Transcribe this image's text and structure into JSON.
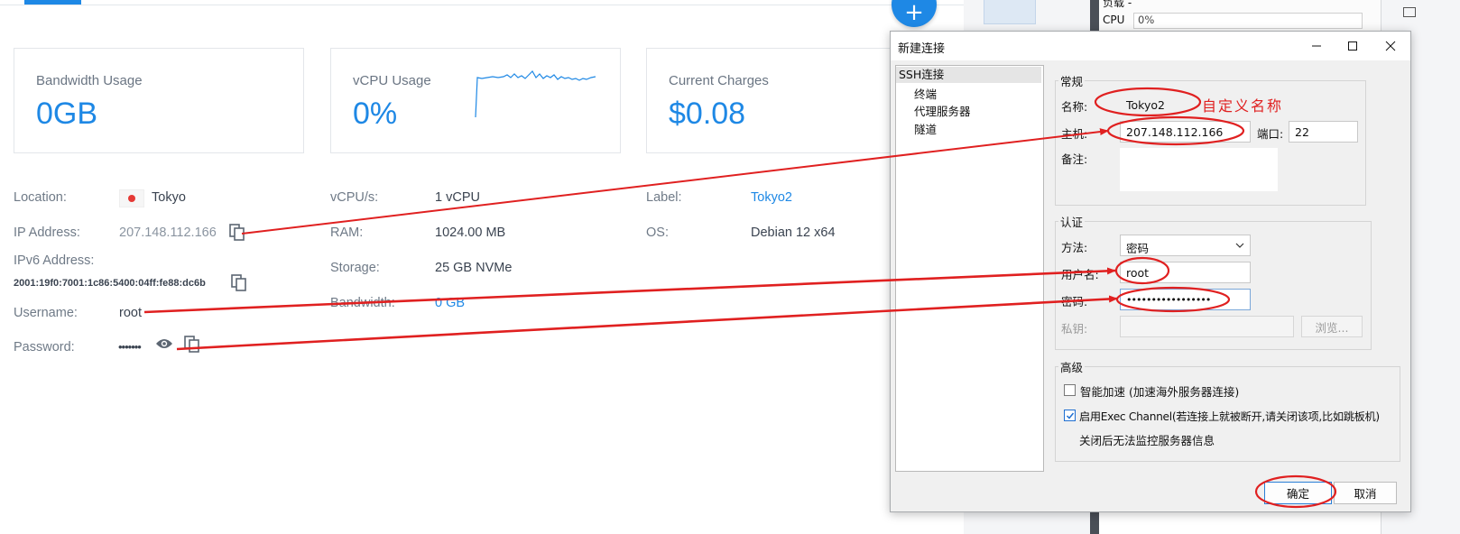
{
  "dashboard": {
    "cards": [
      {
        "title": "Bandwidth Usage",
        "value": "0GB"
      },
      {
        "title": "vCPU Usage",
        "value": "0%"
      },
      {
        "title": "Current Charges",
        "value": "$0.08"
      }
    ],
    "details_col1": {
      "location_label": "Location:",
      "location_value": "Tokyo",
      "ip_label": "IP Address:",
      "ip_value": "207.148.112.166",
      "ipv6_label": "IPv6 Address:",
      "ipv6_value": "2001:19f0:7001:1c86:5400:04ff:fe88:dc6b",
      "username_label": "Username:",
      "username_value": "root",
      "password_label": "Password:",
      "password_value": "•••••••"
    },
    "details_col2": {
      "vcpu_label": "vCPU/s:",
      "vcpu_value": "1 vCPU",
      "ram_label": "RAM:",
      "ram_value": "1024.00 MB",
      "storage_label": "Storage:",
      "storage_value": "25 GB NVMe",
      "bandwidth_label": "Bandwidth:",
      "bandwidth_value": "0 GB"
    },
    "details_col3": {
      "label_label": "Label:",
      "label_value": "Tokyo2",
      "os_label": "OS:",
      "os_value": "Debian 12 x64"
    },
    "add_button_icon": "plus-icon",
    "colors": {
      "accent": "#1e88e5",
      "flag_red": "#e53935",
      "annotation_red": "#e02020"
    }
  },
  "side_panel": {
    "load_label": "负载 -",
    "cpu_label": "CPU",
    "cpu_value": "0%"
  },
  "dialog": {
    "title": "新建连接",
    "tree": {
      "root": "SSH连接",
      "children": [
        "终端",
        "代理服务器",
        "隧道"
      ]
    },
    "general": {
      "group_title": "常规",
      "name_label": "名称:",
      "name_value": "Tokyo2",
      "host_label": "主机:",
      "host_value": "207.148.112.166",
      "port_label": "端口:",
      "port_value": "22",
      "note_label": "备注:",
      "note_value": ""
    },
    "auth": {
      "group_title": "认证",
      "method_label": "方法:",
      "method_value": "密码",
      "user_label": "用户名:",
      "user_value": "root",
      "password_label": "密码:",
      "password_value": "•••••••••••••••••",
      "key_label": "私钥:",
      "key_value": "",
      "browse_label": "浏览..."
    },
    "advanced": {
      "group_title": "高级",
      "smart_accel_label": "智能加速 (加速海外服务器连接)",
      "smart_accel_checked": false,
      "exec_channel_label": "启用Exec Channel(若连接上就被断开,请关闭该项,比如跳板机)",
      "exec_channel_checked": true,
      "exec_channel_note": "关闭后无法监控服务器信息"
    },
    "ok_label": "确定",
    "cancel_label": "取消"
  },
  "annotation": {
    "custom_name_text": "自定义名称"
  }
}
